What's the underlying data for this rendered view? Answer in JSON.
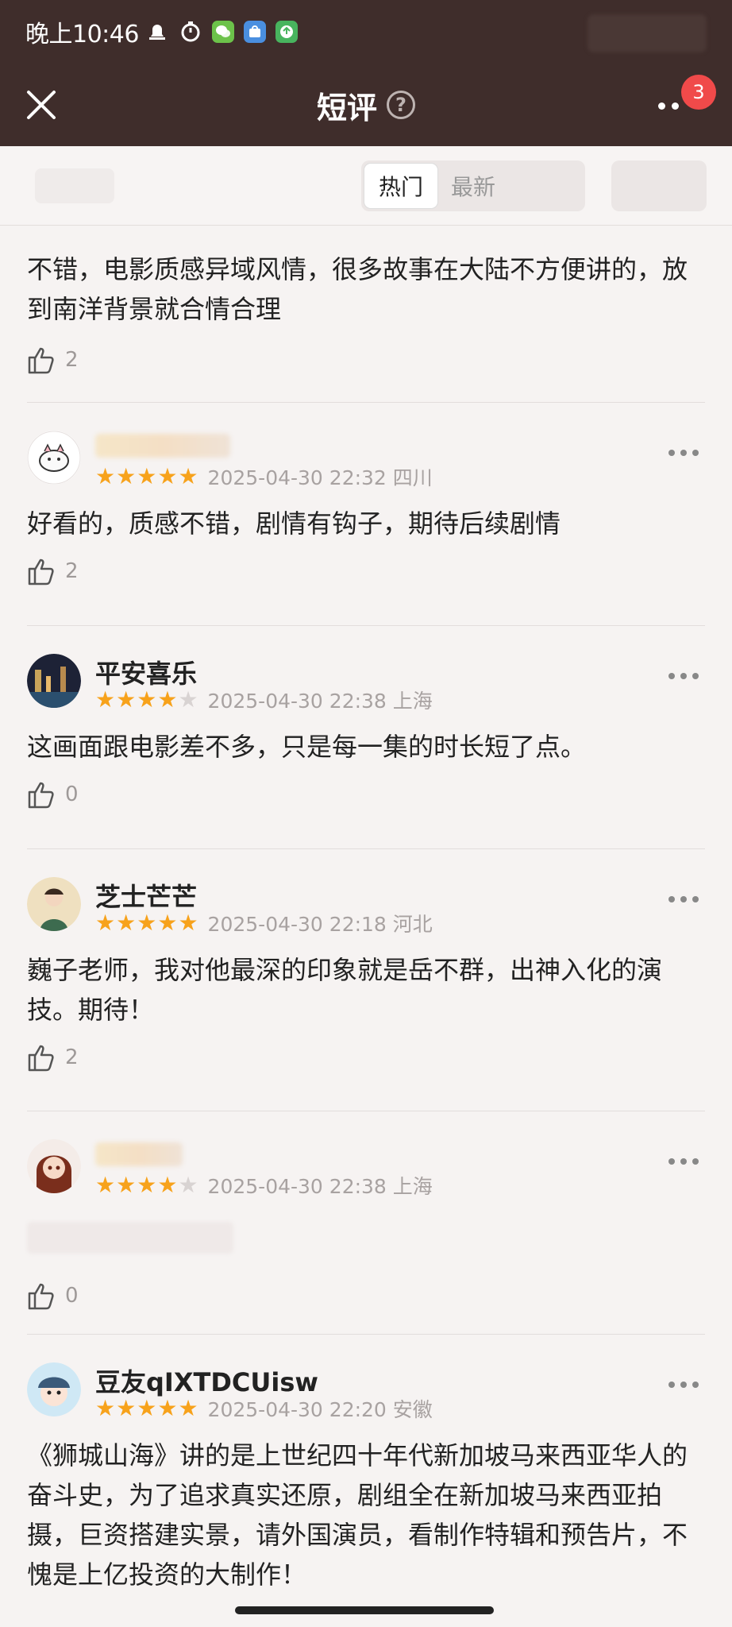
{
  "status": {
    "time": "晚上10:46"
  },
  "nav": {
    "title": "短评",
    "badge": "3"
  },
  "tabs": [
    {
      "label": "热门",
      "active": true
    },
    {
      "label": "最新",
      "active": false
    }
  ],
  "reviews": [
    {
      "text": "不错，电影质感异域风情，很多故事在大陆不方便讲的，放到南洋背景就合情合理",
      "likes": "2"
    },
    {
      "name": "",
      "rating": 5,
      "meta": "2025-04-30 22:32 四川",
      "text": "好看的，质感不错，剧情有钩子，期待后续剧情",
      "likes": "2"
    },
    {
      "name": "平安喜乐",
      "rating": 4,
      "meta": "2025-04-30 22:38 上海",
      "text": "这画面跟电影差不多，只是每一集的时长短了点。",
      "likes": "0"
    },
    {
      "name": "芝士芒芒",
      "rating": 5,
      "meta": "2025-04-30 22:18 河北",
      "text": "巍子老师，我对他最深的印象就是岳不群，出神入化的演技。期待！",
      "likes": "2"
    },
    {
      "name": "",
      "rating": 4,
      "meta": "2025-04-30 22:38 上海",
      "text": "",
      "likes": "0"
    },
    {
      "name": "豆友qIXTDCUisw",
      "rating": 5,
      "meta": "2025-04-30 22:20 安徽",
      "text": "《狮城山海》讲的是上世纪四十年代新加坡马来西亚华人的奋斗史，为了追求真实还原，剧组全在新加坡马来西亚拍摄，巨资搭建实景，请外国演员，看制作特辑和预告片，不愧是上亿投资的大制作！",
      "likes": ""
    }
  ],
  "colors": {
    "header_bg": "#3f2d2b",
    "star": "#f7a21b",
    "badge": "#f04a4a"
  }
}
